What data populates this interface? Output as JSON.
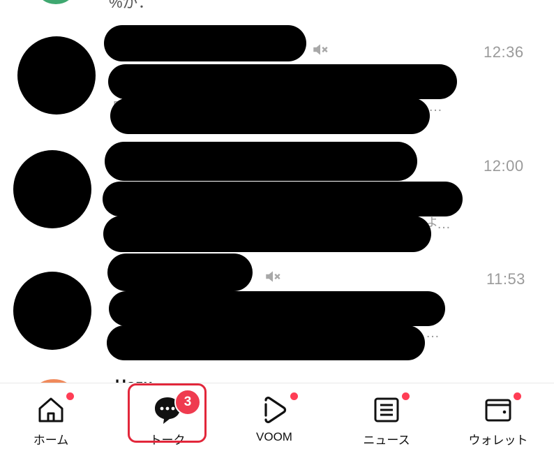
{
  "top_partial": {
    "text": "%が："
  },
  "chats": [
    {
      "time": "12:36",
      "muted": true,
      "preview_peek": "R",
      "ellipsis": "…"
    },
    {
      "time": "12:00",
      "muted": false,
      "preview_peek": "よ",
      "ellipsis": "…"
    },
    {
      "time": "11:53",
      "muted": true,
      "preview_peek": "",
      "ellipsis": "…"
    }
  ],
  "bottom_partial": {
    "name_peek": "Hozu"
  },
  "tabbar": {
    "tabs": [
      {
        "label": "ホーム",
        "icon": "home-icon",
        "has_dot": true
      },
      {
        "label": "トーク",
        "icon": "talk-bubble-icon",
        "badge": "3",
        "selected": true
      },
      {
        "label": "VOOM",
        "icon": "voom-play-icon",
        "has_dot": true
      },
      {
        "label": "ニュース",
        "icon": "news-icon",
        "has_dot": true
      },
      {
        "label": "ウォレット",
        "icon": "wallet-icon",
        "has_dot": true
      }
    ]
  },
  "colors": {
    "badge": "#ef3b4f",
    "dot": "#ff3d55",
    "highlight": "#e2273b",
    "muted_text": "#9a9a9a"
  }
}
